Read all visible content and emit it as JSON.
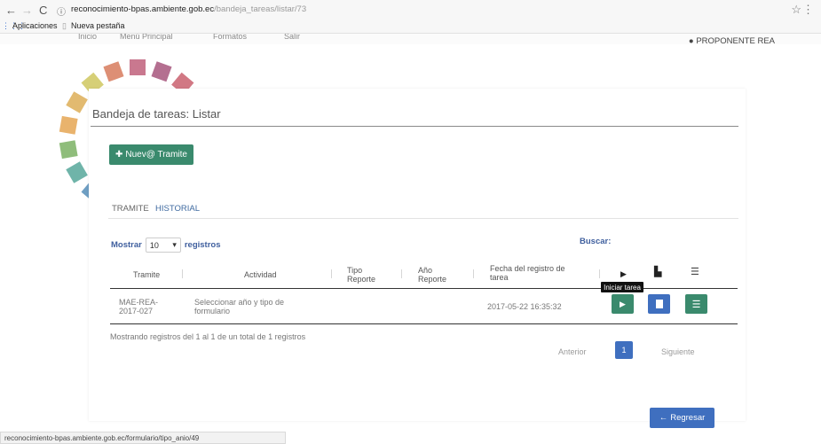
{
  "browser": {
    "url_domain": "reconocimiento-bpas.ambiente.gob.ec",
    "url_path": "/bandeja_tareas/listar/73",
    "bookmarks": [
      "Aplicaciones",
      "Nueva pestaña"
    ],
    "status_url": "reconocimiento-bpas.ambiente.gob.ec/formulario/tipo_anio/49"
  },
  "header": {
    "menu_ghost": [
      "Inicio",
      "Menú Principal",
      "Formatos",
      "Salir"
    ],
    "user_role": "PROPONENTE REA"
  },
  "page": {
    "title": "Bandeja de tareas: Listar",
    "new_button": "Nuev@ Tramite",
    "tabs": [
      {
        "label": "TRAMITE"
      },
      {
        "label": "HISTORIAL"
      }
    ],
    "length_label_before": "Mostrar",
    "length_value": "10",
    "length_label_after": "registros",
    "search_label": "Buscar:"
  },
  "table": {
    "columns": [
      "Tramite",
      "Actividad",
      "Tipo Reporte",
      "Año Reporte",
      "Fecha del registro de tarea"
    ],
    "rows": [
      {
        "tramite": "MAE-REA-2017-027",
        "actividad": "Seleccionar año y tipo de formulario",
        "tipo_reporte": "",
        "anio_reporte": "",
        "fecha": "2017-05-22 16:35:32"
      }
    ],
    "tooltip": "Iniciar tarea",
    "info": "Mostrando registros del 1 al 1 de un total de 1 registros"
  },
  "pagination": {
    "previous": "Anterior",
    "current": "1",
    "next": "Siguiente"
  },
  "footer": {
    "back_button": "Regresar"
  },
  "colors": {
    "green": "#3a8a6d",
    "blue": "#3f6fbf",
    "link_blue": "#3f5f9e"
  }
}
